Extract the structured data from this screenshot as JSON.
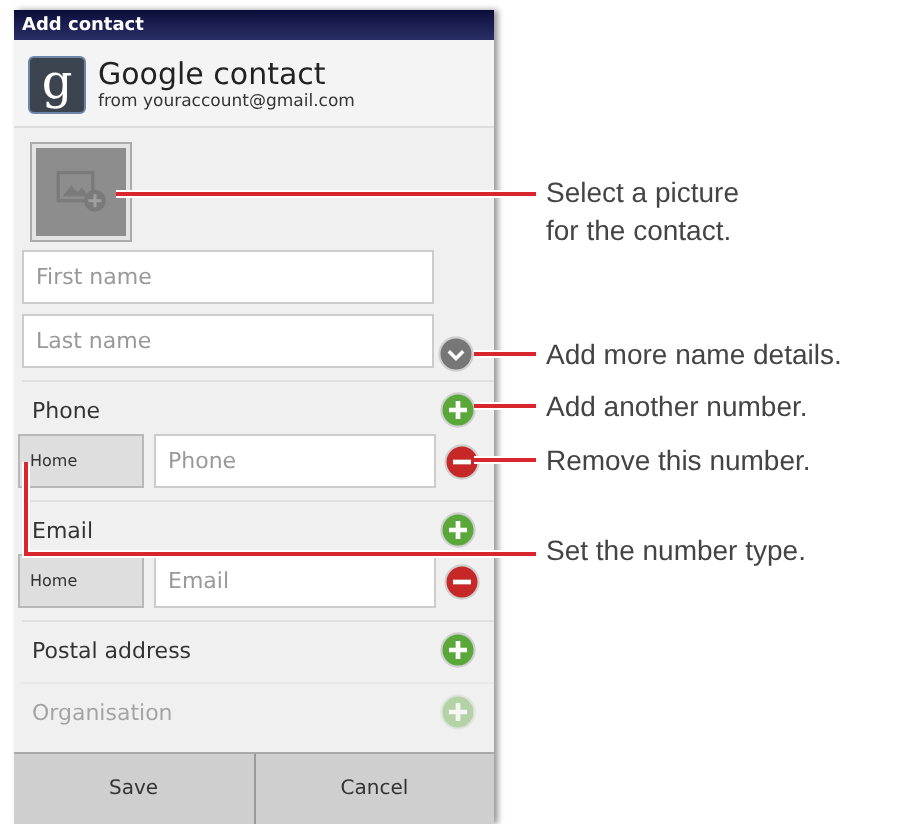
{
  "title_bar": {
    "title": "Add contact"
  },
  "account": {
    "logo": "g",
    "name": "Google contact",
    "email": "from youraccount@gmail.com"
  },
  "name_fields": [
    {
      "placeholder": "First name"
    },
    {
      "placeholder": "Last name"
    }
  ],
  "sections": [
    {
      "label": "Phone",
      "disabled": false,
      "entries": [
        {
          "type": "Home",
          "placeholder": "Phone"
        }
      ]
    },
    {
      "label": "Email",
      "disabled": false,
      "entries": [
        {
          "type": "Home",
          "placeholder": "Email"
        }
      ]
    },
    {
      "label": "Postal address",
      "disabled": false
    },
    {
      "label": "Organisation",
      "disabled": true
    }
  ],
  "buttons": [
    "Save",
    "Cancel"
  ],
  "callouts": [
    {
      "text": "Select a picture for the contact."
    },
    {
      "text": "Add more name details."
    },
    {
      "text": "Add another number."
    },
    {
      "text": "Remove this number."
    },
    {
      "text": "Set the number type."
    }
  ]
}
